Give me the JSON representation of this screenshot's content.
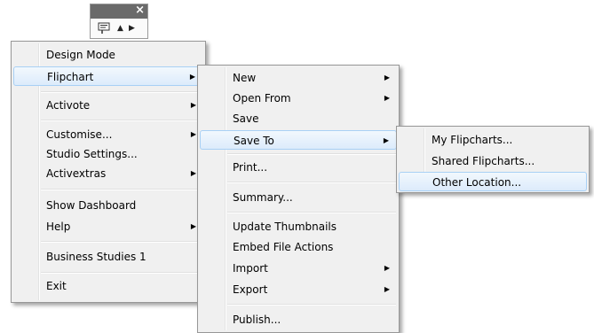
{
  "toolbox": {
    "close": "×",
    "up_arrow": "▲",
    "right_arrow": "▶",
    "icon": "flipchart-page-icon"
  },
  "main_menu": {
    "items": [
      {
        "label": "Design Mode"
      },
      {
        "label": "Flipchart",
        "submenu": true
      },
      {
        "label": "Activote",
        "submenu": true
      },
      {
        "label": "Customise...",
        "submenu": true
      },
      {
        "label": "Studio Settings..."
      },
      {
        "label": "Activextras",
        "submenu": true
      },
      {
        "label": "Show Dashboard"
      },
      {
        "label": "Help",
        "submenu": true
      },
      {
        "label": "Business Studies 1"
      },
      {
        "label": "Exit"
      }
    ]
  },
  "flipchart_menu": {
    "items": [
      {
        "label": "New",
        "submenu": true
      },
      {
        "label": "Open From",
        "submenu": true
      },
      {
        "label": "Save"
      },
      {
        "label": "Save To",
        "submenu": true
      },
      {
        "label": "Print..."
      },
      {
        "label": "Summary..."
      },
      {
        "label": "Update Thumbnails"
      },
      {
        "label": "Embed File Actions"
      },
      {
        "label": "Import",
        "submenu": true
      },
      {
        "label": "Export",
        "submenu": true
      },
      {
        "label": "Publish..."
      }
    ]
  },
  "save_to_menu": {
    "items": [
      {
        "label": "My Flipcharts..."
      },
      {
        "label": "Shared Flipcharts..."
      },
      {
        "label": "Other Location..."
      }
    ]
  },
  "submenu_arrow": "▶",
  "colors": {
    "highlight_border": "#a8d0f5",
    "menu_background": "#f0f0f0",
    "toolbox_bar": "#6a6a6a"
  }
}
